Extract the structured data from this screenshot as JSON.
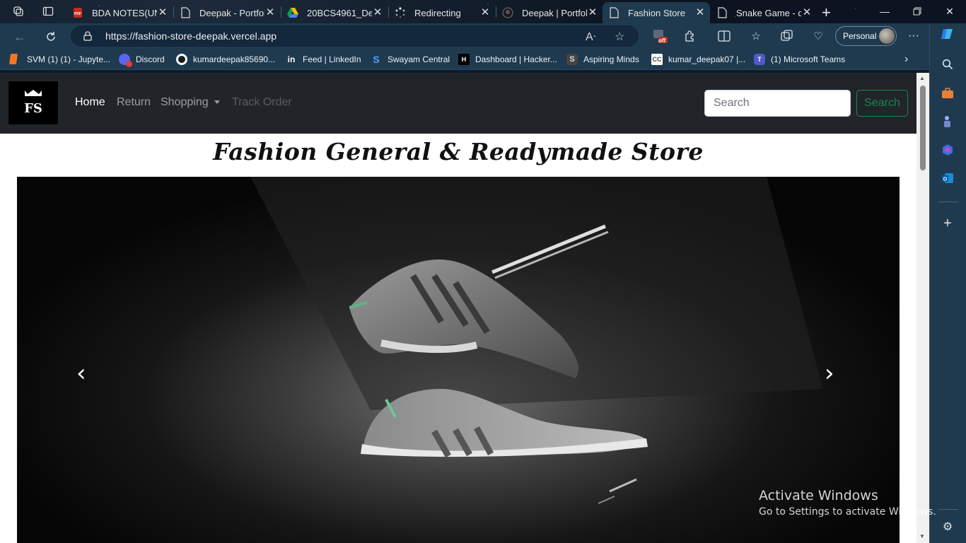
{
  "browser": {
    "tabs": [
      {
        "title": "BDA NOTES(UNI",
        "favicon": "pdf-icon"
      },
      {
        "title": "Deepak - Portfol",
        "favicon": "page-icon"
      },
      {
        "title": "20BCS4961_Dee",
        "favicon": "google-drive-icon"
      },
      {
        "title": "Redirecting",
        "favicon": "loading-icon"
      },
      {
        "title": "Deepak | Portfoli",
        "favicon": "github-icon"
      },
      {
        "title": "Fashion Store",
        "favicon": "page-icon"
      },
      {
        "title": "Snake Game - d",
        "favicon": "page-icon"
      }
    ],
    "active_tab_index": 5,
    "url": "https://fashion-store-deepak.vercel.app",
    "profile_label": "Personal",
    "extension_badge": "off",
    "favorites": [
      {
        "label": "SVM (1) (1) - Jupyte...",
        "icon": "jupyter-icon"
      },
      {
        "label": "Discord",
        "icon": "discord-icon"
      },
      {
        "label": "kumardeepak85690...",
        "icon": "github-icon"
      },
      {
        "label": "Feed | LinkedIn",
        "icon": "linkedin-icon"
      },
      {
        "label": "Swayam Central",
        "icon": "swayam-icon"
      },
      {
        "label": "Dashboard | Hacker...",
        "icon": "hackerrank-icon"
      },
      {
        "label": "Aspiring Minds",
        "icon": "aspiring-minds-icon"
      },
      {
        "label": "kumar_deepak07 |...",
        "icon": "codechef-icon"
      },
      {
        "label": "(1) Microsoft Teams",
        "icon": "teams-icon"
      }
    ]
  },
  "site": {
    "brand_text": "FS",
    "nav": {
      "home": "Home",
      "return": "Return",
      "shopping": "Shopping",
      "track_order": "Track Order"
    },
    "search": {
      "placeholder": "Search",
      "button": "Search"
    },
    "title": "Fashion General & Readymade Store",
    "carousel": {
      "prev_label": "‹",
      "next_label": "›"
    }
  },
  "os_watermark": {
    "line1": "Activate Windows",
    "line2": "Go to Settings to activate Windows."
  },
  "colors": {
    "navbar_bg": "#212529",
    "search_button": "#198754",
    "browser_chrome": "#1f3a4f"
  }
}
